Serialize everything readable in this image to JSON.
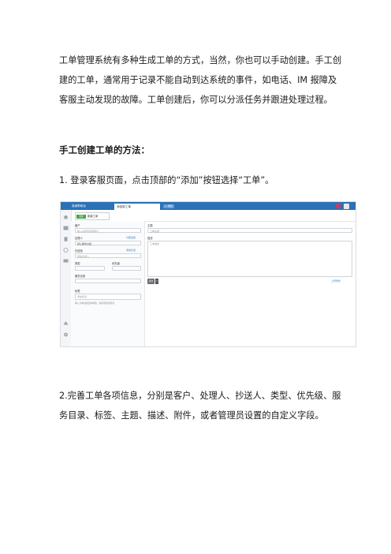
{
  "intro": "工单管理系统有多种生成工单的方式，当然，你也可以手动创建。手工创建的工单，通常用于记录不能自动到达系统的事件，如电话、IM 报障及客服主动发现的故障。工单创建后，你可以分派任务并跟进处理过程。",
  "heading": "手工创建工单的方法：",
  "step1": "1. 登录客服页面，点击顶部的“添加”按钮选择“工单”。",
  "step2": "2.完善工单各项信息，分别是客户、处理人、抄送人、类型、优先级、服务目录、标签、主题、描述、附件，或者管理员设置的自定义字段。",
  "screenshot": {
    "brand": "易维帮助台",
    "tab_active": "添加新工单",
    "tab_add": "+ 添加",
    "new_badge": "新建",
    "new_label": "新建工单",
    "customer_label": "客户",
    "customer_placeholder": "输入关键字搜索客户",
    "assignee_label": "处理人",
    "assignee_link": "分配给我",
    "assignee_value": "默认服务台组",
    "cc_label": "抄送给",
    "cc_link": "添加抄送",
    "cc_placeholder": "添加抄送人",
    "type_label": "类型",
    "type_value": "-",
    "priority_label": "优先级",
    "priority_value": "-",
    "catalog_label": "服务目录",
    "catalog_value": "-",
    "tags_label": "标签",
    "tags_placeholder": "添加标签",
    "tags_note": "输入文本后按回车添加，按标签搜索建议",
    "subject_label": "主题",
    "subject_placeholder": "工单主题",
    "desc_label": "描述",
    "desc_placeholder": "工单描述",
    "attach_link": "上传附件",
    "submit_label": "提交"
  }
}
